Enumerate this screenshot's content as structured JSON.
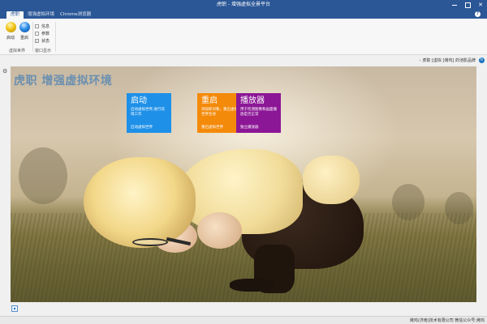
{
  "window": {
    "title": "虎职 - 增强虚拟全景平台",
    "controls": {
      "help": "?"
    }
  },
  "tabs": [
    {
      "label": "虎职",
      "active": true
    },
    {
      "label": "增强虚拟环境",
      "active": false
    },
    {
      "label": "Chrome浏览器",
      "active": false
    }
  ],
  "ribbon": {
    "buttons": [
      {
        "label": "启动",
        "icon": "yellow-orb-icon"
      },
      {
        "label": "重启",
        "icon": "blue-orb-icon"
      }
    ],
    "checkboxes": [
      {
        "label": "信息",
        "checked": false
      },
      {
        "label": "参数",
        "checked": false
      },
      {
        "label": "状态",
        "checked": true
      }
    ],
    "groups": [
      {
        "label": "虚拟世界"
      },
      {
        "label": "窗口显示"
      }
    ]
  },
  "address": {
    "breadcrumb": "虎职 [虚拟 [烤鸡] 的池影品牌"
  },
  "content": {
    "heading": "虎职 增强虚拟环境",
    "tiles": [
      {
        "title": "启动",
        "desc": "启动虚拟世界,进行双境工作",
        "link": "启动虚拟世界",
        "color": "#1e90e8"
      },
      {
        "title": "重启",
        "desc": "添加新对象，重启虚拟世界生效",
        "link": "重启虚拟世界",
        "color": "#f48a0a"
      },
      {
        "title": "播放器",
        "desc": "用于检测图像和画面播放是否正常",
        "link": "独立播放器",
        "color": "#8c1796"
      }
    ]
  },
  "status": {
    "text": "烤鸡(济南)技术有限公司  微信公众号:烤鸡"
  }
}
